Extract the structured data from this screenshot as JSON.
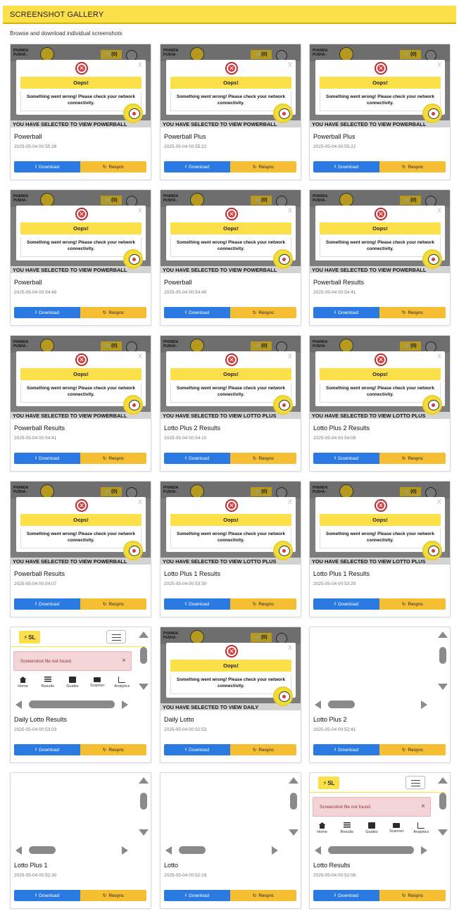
{
  "header": {
    "title": "SCREENSHOT GALLERY"
  },
  "subtitle": "Browse and download individual screenshots",
  "buttons": {
    "download": "Download",
    "resync": "Resync"
  },
  "error_screen": {
    "brand": "PHANDA PUSHA -",
    "cart": "(0)",
    "modal_close": "X",
    "modal_icon": "✕",
    "modal_title": "Oops!",
    "modal_message": "Something went wrong! Please check your network connectivity."
  },
  "app_screen": {
    "logo": "SL",
    "alert": "Screenshot file not found",
    "alert_close": "×",
    "nav": [
      "Home",
      "Results",
      "Guides",
      "Scanner",
      "Analytics"
    ]
  },
  "cards": [
    {
      "title": "Powerball",
      "timestamp": "2025-05-04 00:55:26",
      "banner": "YOU HAVE SELECTED TO VIEW POWERBALL",
      "thumb": "error"
    },
    {
      "title": "Powerball Plus",
      "timestamp": "2025-05-04 00:55:22",
      "banner": "YOU HAVE SELECTED TO VIEW POWERBALL",
      "thumb": "error"
    },
    {
      "title": "Powerball Plus",
      "timestamp": "2025-05-04 00:55:22",
      "banner": "YOU HAVE SELECTED TO VIEW POWERBALL",
      "thumb": "error"
    },
    {
      "title": "Powerball",
      "timestamp": "2025-05-04 00:54:49",
      "banner": "YOU HAVE SELECTED TO VIEW POWERBALL",
      "thumb": "error"
    },
    {
      "title": "Powerball",
      "timestamp": "2025-05-04 00:54:49",
      "banner": "YOU HAVE SELECTED TO VIEW POWERBALL",
      "thumb": "error"
    },
    {
      "title": "Powerball Results",
      "timestamp": "2025-05-04 00:54:41",
      "banner": "YOU HAVE SELECTED TO VIEW POWERBALL",
      "thumb": "error"
    },
    {
      "title": "Powerball Results",
      "timestamp": "2025-05-04 00:54:41",
      "banner": "YOU HAVE SELECTED TO VIEW POWERBALL",
      "thumb": "error"
    },
    {
      "title": "Lotto Plus 2 Results",
      "timestamp": "2025-05-04 00:54:10",
      "banner": "YOU HAVE SELECTED TO VIEW LOTTO PLUS",
      "thumb": "error"
    },
    {
      "title": "Lotto Plus 2 Results",
      "timestamp": "2025-05-04 00:54:09",
      "banner": "YOU HAVE SELECTED TO VIEW LOTTO PLUS",
      "thumb": "error"
    },
    {
      "title": "Powerball Results",
      "timestamp": "2025-05-04 00:54:07",
      "banner": "YOU HAVE SELECTED TO VIEW POWERBALL",
      "thumb": "error"
    },
    {
      "title": "Lotto Plus 1 Results",
      "timestamp": "2025-05-04 00:53:30",
      "banner": "YOU HAVE SELECTED TO VIEW LOTTO PLUS",
      "thumb": "error"
    },
    {
      "title": "Lotto Plus 1 Results",
      "timestamp": "2025-05-04 00:53:29",
      "banner": "YOU HAVE SELECTED TO VIEW LOTTO PLUS",
      "thumb": "error"
    },
    {
      "title": "Daily Lotto Results",
      "timestamp": "2025-05-04 00:53:03",
      "thumb": "app"
    },
    {
      "title": "Daily Lotto",
      "timestamp": "2025-05-04 00:52:53",
      "banner": "YOU HAVE SELECTED TO VIEW DAILY",
      "thumb": "error"
    },
    {
      "title": "Lotto Plus 2",
      "timestamp": "2025-05-04 00:52:41",
      "thumb": "blank"
    },
    {
      "title": "Lotto Plus 1",
      "timestamp": "2025-05-04 00:52:30",
      "thumb": "blank"
    },
    {
      "title": "Lotto",
      "timestamp": "2025-05-04 00:52:18",
      "thumb": "blank-small"
    },
    {
      "title": "Lotto Results",
      "timestamp": "2025-05-04 00:52:06",
      "thumb": "app"
    }
  ]
}
